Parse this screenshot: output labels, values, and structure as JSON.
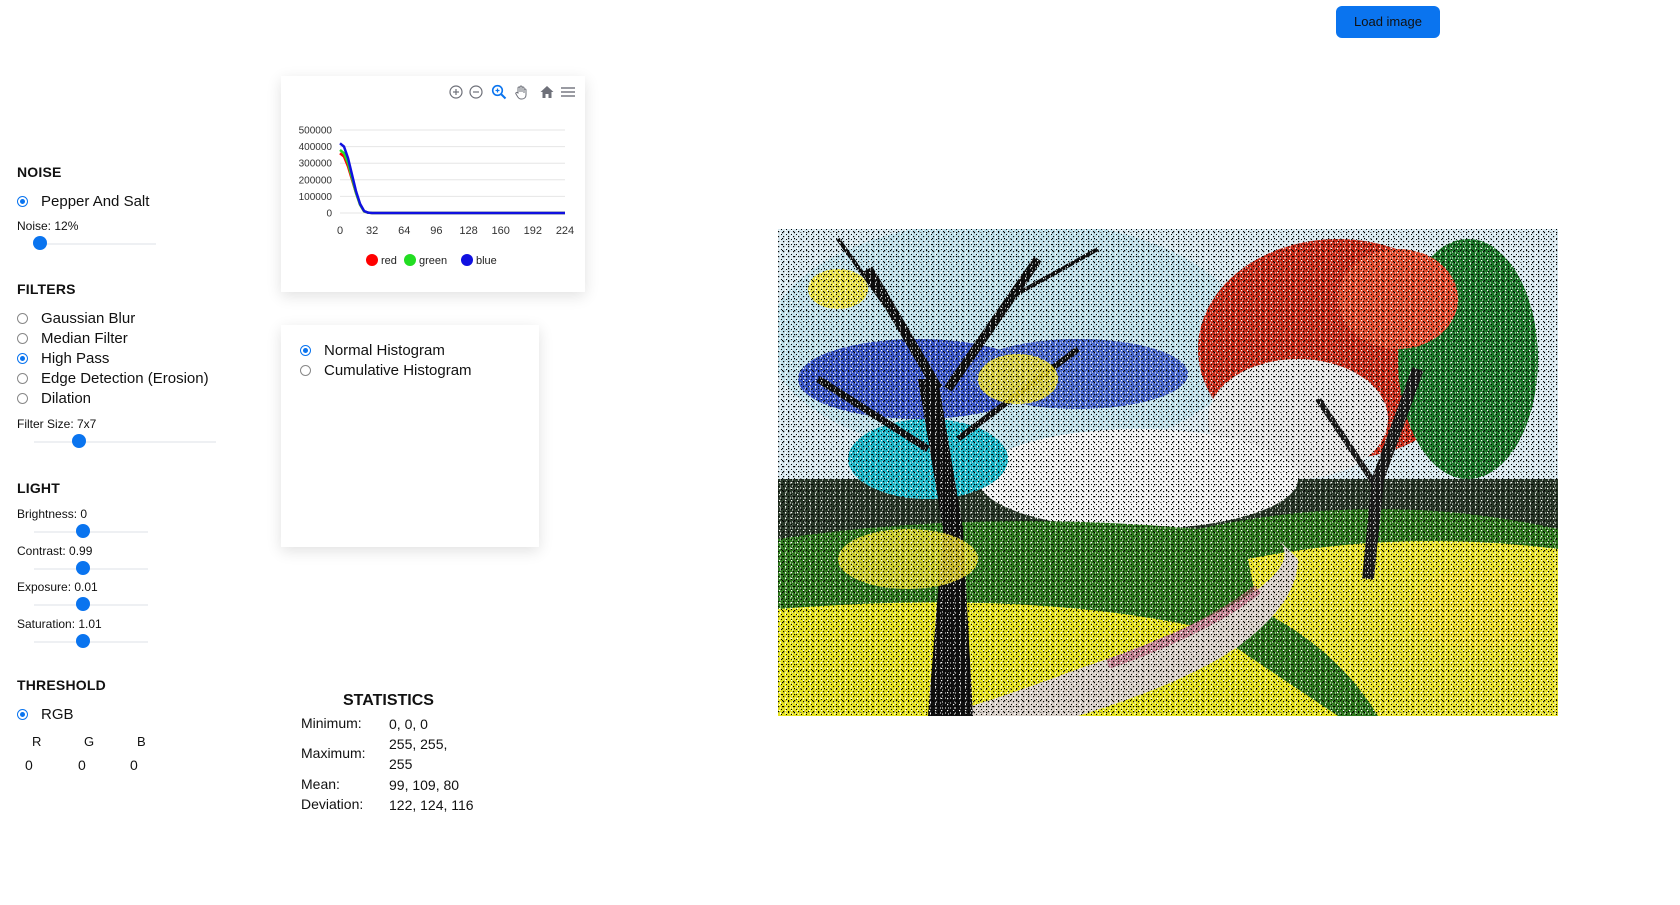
{
  "header": {
    "load_button": "Load image"
  },
  "noise": {
    "title": "NOISE",
    "options": [
      "Pepper And Salt"
    ],
    "selected": 0,
    "slider_label": "Noise: 12%",
    "slider_value": 0.12
  },
  "filters": {
    "title": "FILTERS",
    "options": [
      "Gaussian Blur",
      "Median Filter",
      "High Pass",
      "Edge Detection (Erosion)",
      "Dilation"
    ],
    "selected": 2,
    "slider_label": "Filter Size: 7x7"
  },
  "light": {
    "title": "LIGHT",
    "brightness_label": "Brightness: 0",
    "contrast_label": "Contrast: 0.99",
    "exposure_label": "Exposure: 0.01",
    "saturation_label": "Saturation: 1.01"
  },
  "threshold": {
    "title": "THRESHOLD",
    "options": [
      "RGB"
    ],
    "selected": 0,
    "channels": [
      "R",
      "G",
      "B"
    ],
    "values": [
      "0",
      "0",
      "0"
    ]
  },
  "histogram_mode": {
    "options": [
      "Normal Histogram",
      "Cumulative Histogram"
    ],
    "selected": 0
  },
  "toolbar_icons": [
    "zoom-in-icon",
    "zoom-out-icon",
    "zoom-selection-icon",
    "pan-hand-icon",
    "home-reset-icon",
    "menu-icon"
  ],
  "chart_data": {
    "type": "line",
    "y_ticks": [
      "500000",
      "400000",
      "300000",
      "200000",
      "100000",
      "0"
    ],
    "x_ticks": [
      "0",
      "32",
      "64",
      "96",
      "128",
      "160",
      "192",
      "224"
    ],
    "ylim": [
      0,
      500000
    ],
    "xlim": [
      0,
      224
    ],
    "series": [
      {
        "name": "red",
        "color": "#ff0000",
        "x": [
          0,
          4,
          8,
          12,
          16,
          20,
          24,
          28,
          32,
          64,
          128,
          224
        ],
        "values": [
          360000,
          340000,
          280000,
          200000,
          120000,
          50000,
          10000,
          2000,
          0,
          0,
          0,
          0
        ]
      },
      {
        "name": "green",
        "color": "#22dd22",
        "x": [
          0,
          4,
          8,
          12,
          16,
          20,
          24,
          28,
          32,
          64,
          128,
          224
        ],
        "values": [
          380000,
          360000,
          300000,
          210000,
          120000,
          50000,
          10000,
          2000,
          0,
          0,
          0,
          0
        ]
      },
      {
        "name": "blue",
        "color": "#1010e0",
        "x": [
          0,
          4,
          8,
          12,
          16,
          20,
          24,
          28,
          32,
          64,
          128,
          224
        ],
        "values": [
          420000,
          400000,
          330000,
          230000,
          130000,
          55000,
          12000,
          2000,
          0,
          0,
          0,
          0
        ]
      }
    ]
  },
  "statistics": {
    "title": "STATISTICS",
    "rows": [
      {
        "label": "Minimum:",
        "value": "0, 0, 0"
      },
      {
        "label": "Maximum:",
        "value": "255, 255, 255"
      },
      {
        "label": "Mean:",
        "value": "99, 109, 80"
      },
      {
        "label": "Deviation:",
        "value": "122, 124, 116"
      }
    ]
  }
}
